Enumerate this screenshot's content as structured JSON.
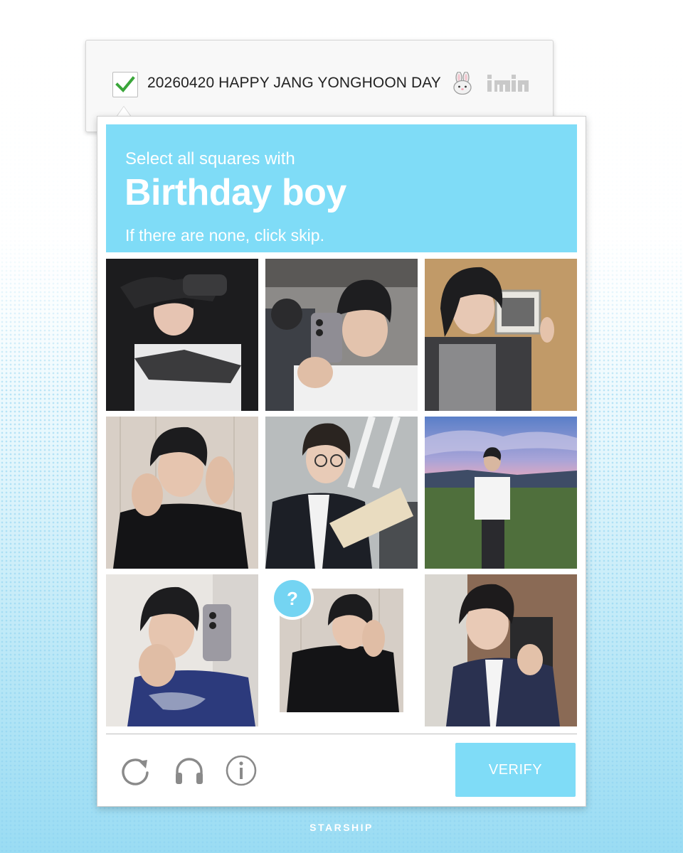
{
  "widget": {
    "title": "20260420 HAPPY JANG YONGHOON DAY",
    "checked": true,
    "icons": [
      "check-icon",
      "rabbit-emoji-icon",
      "group-logo-icon"
    ]
  },
  "challenge": {
    "pre_text": "Select all squares with",
    "strong_text": "Birthday boy",
    "sub_text": "If there are none, click skip.",
    "header_color": "#7fdcf7",
    "tiles": [
      {
        "id": 1,
        "photo": "photo-black-gloves-pose",
        "selected": false
      },
      {
        "id": 2,
        "photo": "photo-mirror-selfie-phone",
        "selected": false
      },
      {
        "id": 3,
        "photo": "photo-wood-wall-profile",
        "selected": false
      },
      {
        "id": 4,
        "photo": "photo-hands-frame-face",
        "selected": false
      },
      {
        "id": 5,
        "photo": "photo-reading-book-glasses",
        "selected": false
      },
      {
        "id": 6,
        "photo": "photo-field-sunset-sky",
        "selected": false
      },
      {
        "id": 7,
        "photo": "photo-mirror-selfie-rings",
        "selected": false
      },
      {
        "id": 8,
        "photo": "photo-hand-on-cheek",
        "selected": true,
        "badge": "?"
      },
      {
        "id": 9,
        "photo": "photo-school-uniform",
        "selected": false
      }
    ]
  },
  "footer": {
    "icons": [
      "reload-icon",
      "headphones-icon",
      "info-icon"
    ],
    "verify_label": "VERIFY"
  },
  "brand": "STARSHIP"
}
